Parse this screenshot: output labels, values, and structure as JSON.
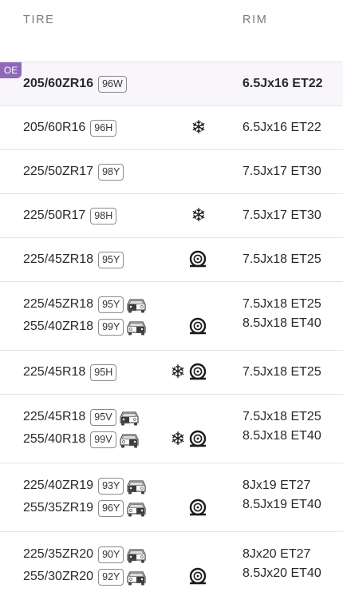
{
  "header": {
    "tire_label": "TIRE",
    "rim_label": "RIM"
  },
  "oe_label": "OE",
  "icons": {
    "snowflake": "snowflake-icon",
    "runflat": "runflat-tire-icon",
    "front_axle": "front-axle-car-icon",
    "rear_axle": "rear-axle-car-icon"
  },
  "rows": [
    {
      "tire1": "205/60ZR16",
      "load1": "96W",
      "rim1": "6.5Jx16 ET22",
      "oe": true
    },
    {
      "tire1": "205/60R16",
      "load1": "96H",
      "rim1": "6.5Jx16 ET22",
      "winter": true
    },
    {
      "tire1": "225/50ZR17",
      "load1": "98Y",
      "rim1": "7.5Jx17 ET30"
    },
    {
      "tire1": "225/50R17",
      "load1": "98H",
      "rim1": "7.5Jx17 ET30",
      "winter": true
    },
    {
      "tire1": "225/45ZR18",
      "load1": "95Y",
      "rim1": "7.5Jx18 ET25",
      "runflat": true
    },
    {
      "tire1": "225/45ZR18",
      "load1": "95Y",
      "rim1": "7.5Jx18 ET25",
      "tire2": "255/40ZR18",
      "load2": "99Y",
      "rim2": "8.5Jx18 ET40",
      "runflat": true
    },
    {
      "tire1": "225/45R18",
      "load1": "95H",
      "rim1": "7.5Jx18 ET25",
      "winter": true,
      "runflat": true
    },
    {
      "tire1": "225/45R18",
      "load1": "95V",
      "rim1": "7.5Jx18 ET25",
      "tire2": "255/40R18",
      "load2": "99V",
      "rim2": "8.5Jx18 ET40",
      "winter": true,
      "runflat": true
    },
    {
      "tire1": "225/40ZR19",
      "load1": "93Y",
      "rim1": "8Jx19 ET27",
      "tire2": "255/35ZR19",
      "load2": "96Y",
      "rim2": "8.5Jx19 ET40",
      "runflat": true
    },
    {
      "tire1": "225/35ZR20",
      "load1": "90Y",
      "rim1": "8Jx20 ET27",
      "tire2": "255/30ZR20",
      "load2": "92Y",
      "rim2": "8.5Jx20 ET40",
      "runflat": true
    }
  ]
}
